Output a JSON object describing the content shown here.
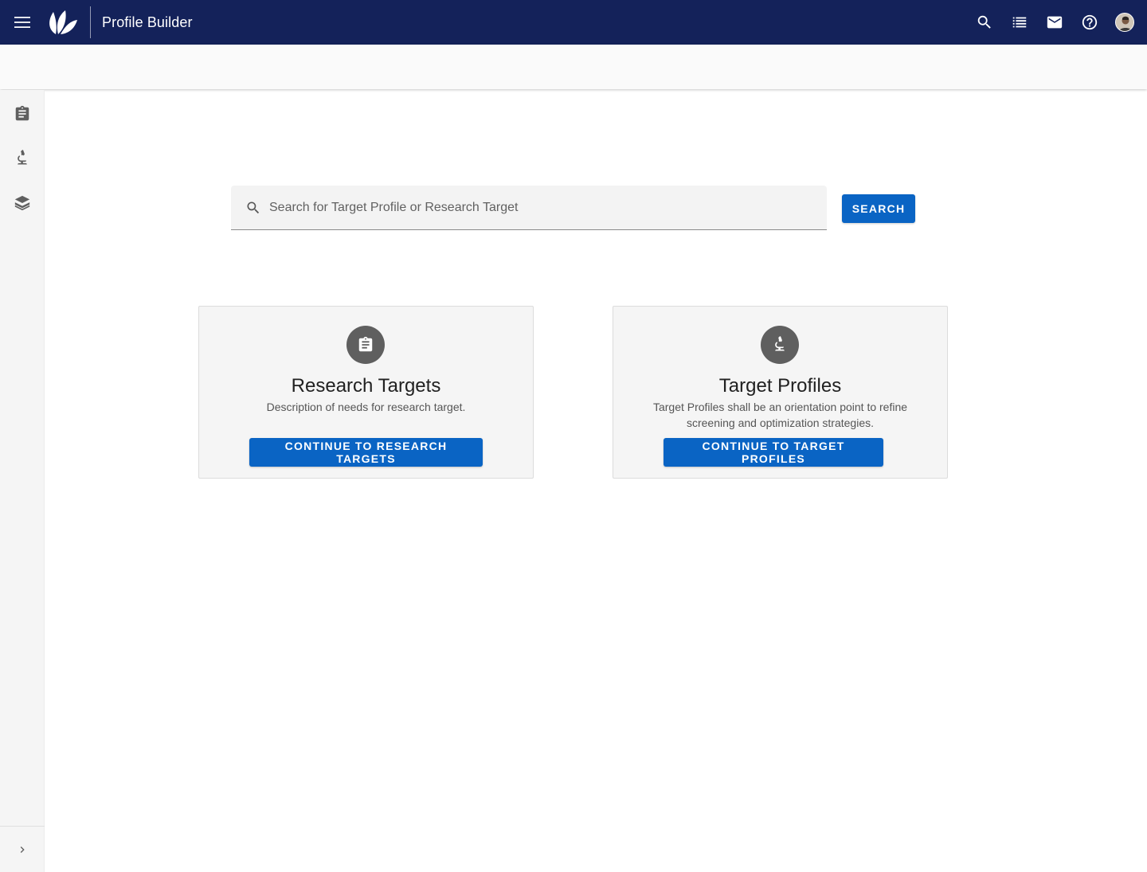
{
  "header": {
    "app_title": "Profile Builder",
    "menu_icon": "hamburger-menu-icon",
    "logo_icon": "leaf-logo-icon",
    "actions": [
      "search-icon",
      "list-icon",
      "mail-icon",
      "help-icon",
      "avatar"
    ],
    "bg_color": "#14225a"
  },
  "rail": {
    "items": [
      "clipboard-icon",
      "microscope-icon",
      "layers-icon"
    ],
    "expand_icon": "chevron-right-icon"
  },
  "search": {
    "placeholder": "Search for Target Profile or Research Target",
    "value": "",
    "button_label": "SEARCH"
  },
  "cards": [
    {
      "icon": "clipboard-icon",
      "title": "Research Targets",
      "description": "Description of needs for research target.",
      "button_label": "CONTINUE TO RESEARCH TARGETS"
    },
    {
      "icon": "microscope-icon",
      "title": "Target Profiles",
      "description": "Target Profiles shall be an orientation point to refine screening and optimization strategies.",
      "button_label": "CONTINUE TO TARGET PROFILES"
    }
  ],
  "colors": {
    "primary_button": "#0a64c4",
    "card_background": "#f5f5f5",
    "icon_circle": "#5f5f5f"
  }
}
